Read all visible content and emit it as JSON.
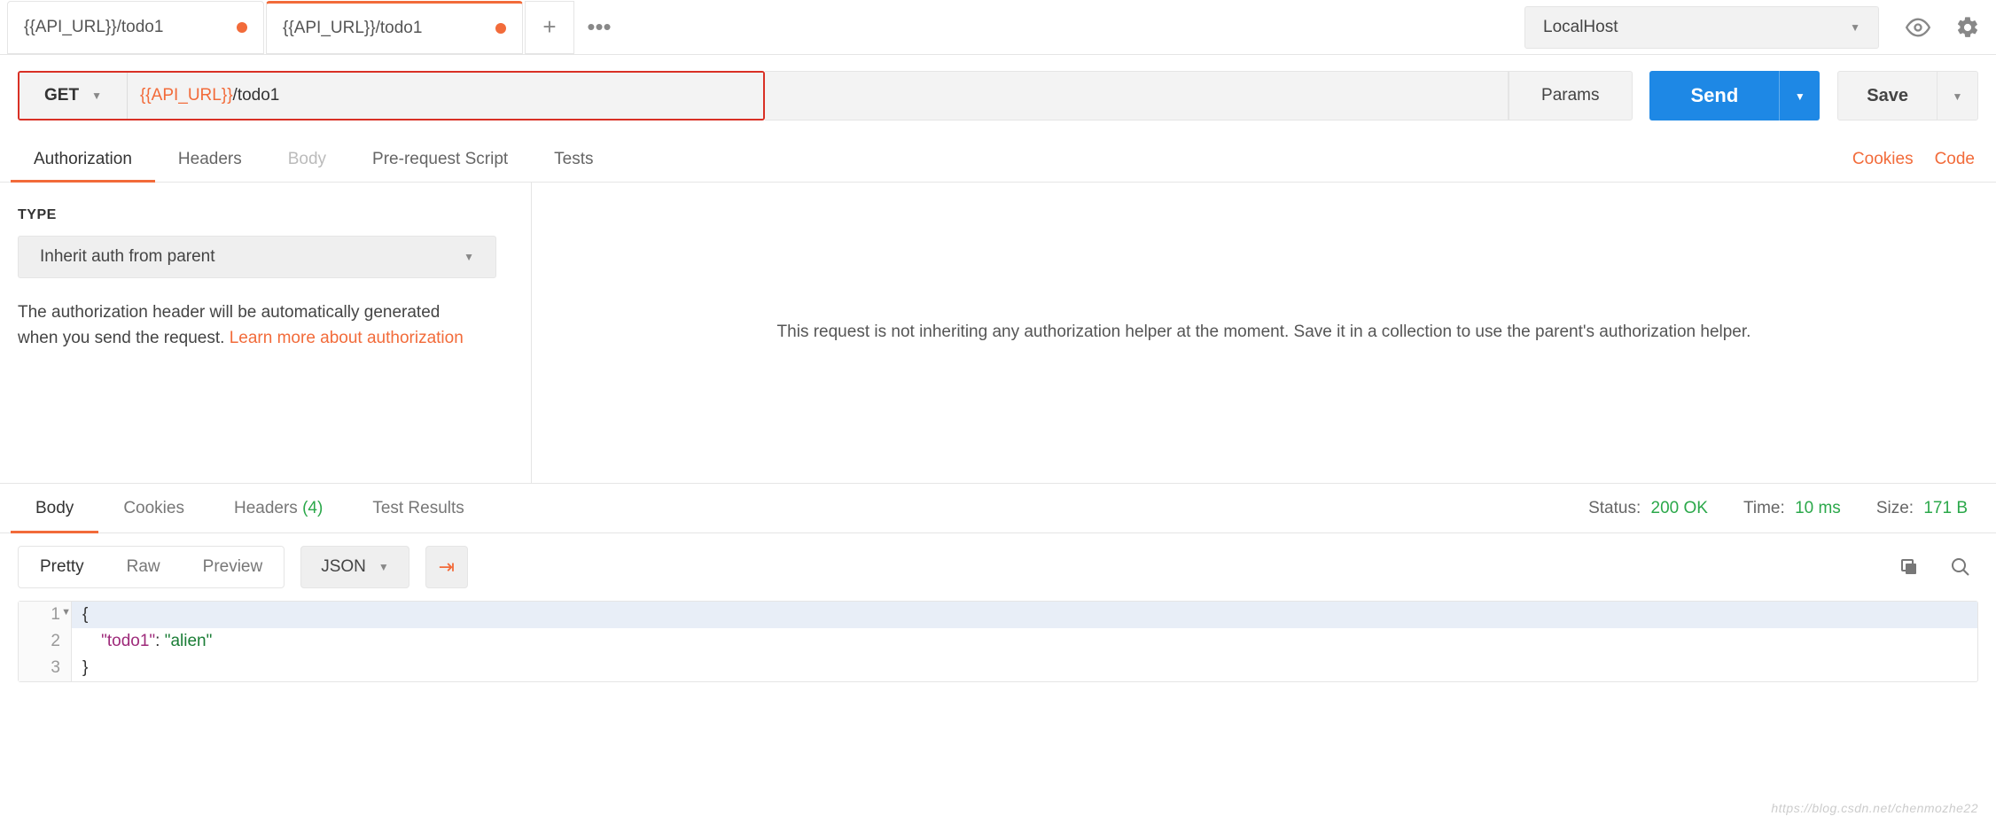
{
  "tabs": [
    {
      "label": "{{API_URL}}/todo1",
      "dirty": true,
      "active": false
    },
    {
      "label": "{{API_URL}}/todo1",
      "dirty": true,
      "active": true
    }
  ],
  "env": {
    "selected": "LocalHost"
  },
  "request": {
    "method": "GET",
    "url_var": "{{API_URL}}",
    "url_rest": "/todo1",
    "params_btn": "Params",
    "send": "Send",
    "save": "Save"
  },
  "req_sections": {
    "authorization": "Authorization",
    "headers": "Headers",
    "body": "Body",
    "prerequest": "Pre-request Script",
    "tests": "Tests",
    "cookies_link": "Cookies",
    "code_link": "Code"
  },
  "auth": {
    "type_label": "TYPE",
    "type_selected": "Inherit auth from parent",
    "desc_prefix": "The authorization header will be automatically generated when you send the request. ",
    "desc_link": "Learn more about authorization",
    "right_message": "This request is not inheriting any authorization helper at the moment. Save it in a collection to use the parent's authorization helper."
  },
  "response": {
    "tabs": {
      "body": "Body",
      "cookies": "Cookies",
      "headers": "Headers",
      "headers_count": "(4)",
      "test_results": "Test Results"
    },
    "status_label": "Status:",
    "status_value": "200 OK",
    "time_label": "Time:",
    "time_value": "10 ms",
    "size_label": "Size:",
    "size_value": "171 B"
  },
  "body_toolbar": {
    "pretty": "Pretty",
    "raw": "Raw",
    "preview": "Preview",
    "format": "JSON"
  },
  "response_body": {
    "lines": [
      {
        "n": "1",
        "text": "{",
        "fold": true
      },
      {
        "n": "2",
        "text": "    \"todo1\": \"alien\""
      },
      {
        "n": "3",
        "text": "}"
      }
    ]
  },
  "watermark": "https://blog.csdn.net/chenmozhe22"
}
